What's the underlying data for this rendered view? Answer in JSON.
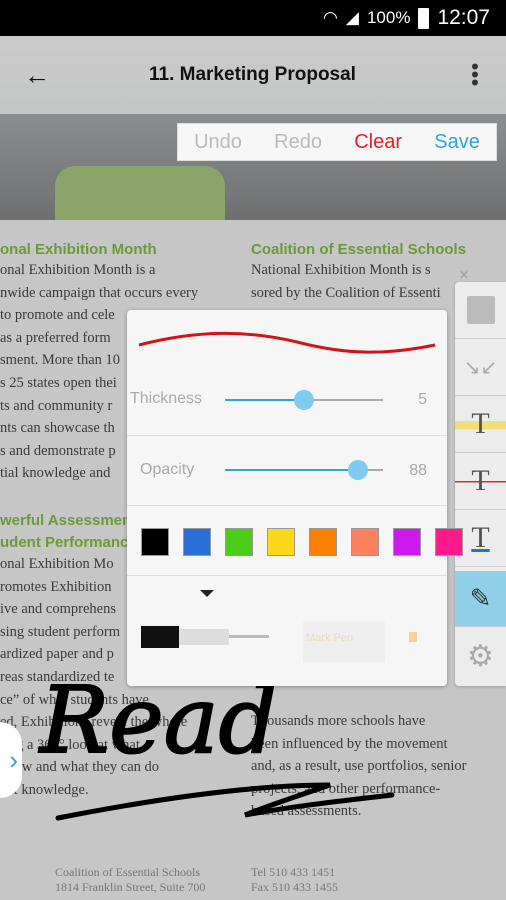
{
  "status": {
    "battery": "100%",
    "time": "12:07"
  },
  "appbar": {
    "title": "11. Marketing Proposal"
  },
  "editbar": {
    "undo": "Undo",
    "redo": "Redo",
    "clear": "Clear",
    "save": "Save"
  },
  "doc": {
    "left_heading": "onal Exhibition Month",
    "left_lines": [
      "onal Exhibition Month is a",
      "nwide campaign that occurs every",
      "to promote and cele",
      "as a preferred form",
      "sment. More than 10",
      "s 25 states open thei",
      "ts and community r",
      "nts can showcase th",
      "s and demonstrate p",
      "tial knowledge and"
    ],
    "left_heading2": [
      "werful Assessmen",
      "udent Performanc"
    ],
    "left_lines2": [
      "onal Exhibition Mo",
      "romotes Exhibition",
      "ive and comprehens",
      "sing student perform",
      "ardized paper and p",
      "reas standardized te",
      "ce” of what students have",
      "ed, Exhibitions reveal the whole",
      "ring a 360° look at what",
      " know and what they can do",
      "hat knowledge."
    ],
    "right_heading": "Coalition of Essential Schools",
    "right_lines": [
      "National Exhibition Month is s",
      "sored by the Coalition of Essenti"
    ],
    "right_lines2": [
      "Thousands more schools have",
      "been influenced by the movement",
      "and, as a result, use portfolios, senior",
      "projects, and other performance-",
      "based assessments."
    ],
    "footer_left": [
      "Coalition of Essential Schools",
      "1814 Franklin Street, Suite 700"
    ],
    "footer_right": [
      "Tel 510 433 1451",
      "Fax 510 433 1455"
    ],
    "handwriting": "Read"
  },
  "pen_panel": {
    "preview_color": "#d0141c",
    "thickness_label": "Thickness",
    "thickness": 5,
    "thickness_fraction": 0.5,
    "opacity_label": "Opacity",
    "opacity": 88,
    "opacity_fraction": 0.84,
    "colors": [
      "#000000",
      "#2a6fd6",
      "#4ccd1a",
      "#ffd81a",
      "#ff7f00",
      "#ff8060",
      "#cc1aee",
      "#ff1a8c"
    ],
    "pens": [
      "fountain-pen",
      "marker-pen"
    ],
    "marker_label": "Mark Pen"
  },
  "tools": [
    "save-icon",
    "collapse-icon",
    "highlight-text-icon",
    "strikethrough-text-icon",
    "underline-text-icon",
    "pen-icon",
    "settings-icon"
  ],
  "accent": "#2ea3e0"
}
